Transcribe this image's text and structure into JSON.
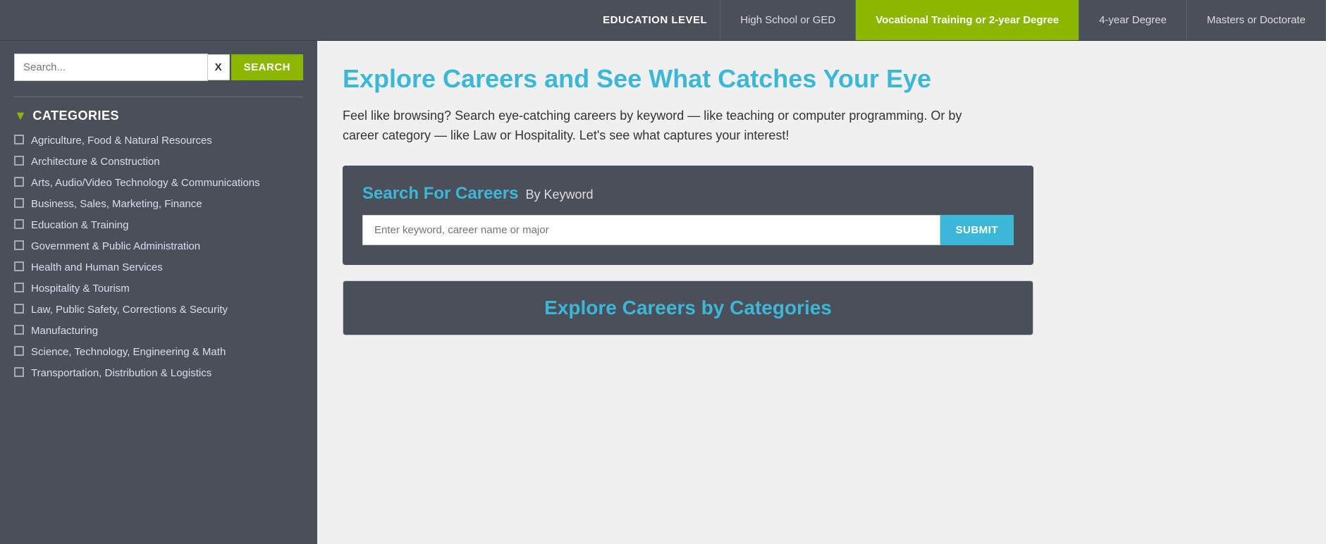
{
  "topnav": {
    "edu_label": "EDUCATION LEVEL",
    "tabs": [
      {
        "id": "highschool",
        "label": "High School or GED",
        "active": false
      },
      {
        "id": "vocational",
        "label": "Vocational Training or 2-year Degree",
        "active": true
      },
      {
        "id": "fouryear",
        "label": "4-year Degree",
        "active": false
      },
      {
        "id": "masters",
        "label": "Masters or Doctorate",
        "active": false
      }
    ]
  },
  "sidebar": {
    "search_placeholder": "Search...",
    "clear_label": "X",
    "search_button": "SEARCH",
    "categories_header": "CATEGORIES",
    "categories": [
      {
        "id": "agri",
        "label": "Agriculture, Food & Natural Resources"
      },
      {
        "id": "arch",
        "label": "Architecture & Construction"
      },
      {
        "id": "arts",
        "label": "Arts, Audio/Video Technology & Communications"
      },
      {
        "id": "biz",
        "label": "Business, Sales, Marketing, Finance"
      },
      {
        "id": "edu",
        "label": "Education & Training"
      },
      {
        "id": "gov",
        "label": "Government & Public Administration"
      },
      {
        "id": "health",
        "label": "Health and Human Services"
      },
      {
        "id": "hosp",
        "label": "Hospitality & Tourism"
      },
      {
        "id": "law",
        "label": "Law, Public Safety, Corrections & Security"
      },
      {
        "id": "mfg",
        "label": "Manufacturing"
      },
      {
        "id": "stem",
        "label": "Science, Technology, Engineering & Math"
      },
      {
        "id": "trans",
        "label": "Transportation, Distribution & Logistics"
      }
    ]
  },
  "content": {
    "hero_title": "Explore Careers and See What Catches Your Eye",
    "hero_desc": "Feel like browsing? Search eye-catching careers by keyword — like teaching or computer programming. Or by career category — like Law or Hospitality. Let's see what captures your interest!",
    "search_box": {
      "title": "Search For Careers",
      "by_keyword": "By Keyword",
      "input_placeholder": "Enter keyword, career name or major",
      "submit_label": "SUBMIT"
    },
    "categories_box": {
      "title": "Explore Careers by Categories"
    }
  },
  "colors": {
    "active_tab_bg": "#8db600",
    "accent_blue": "#3bb8d8",
    "sidebar_bg": "#4a4f5a",
    "content_bg": "#f0f0f0"
  }
}
